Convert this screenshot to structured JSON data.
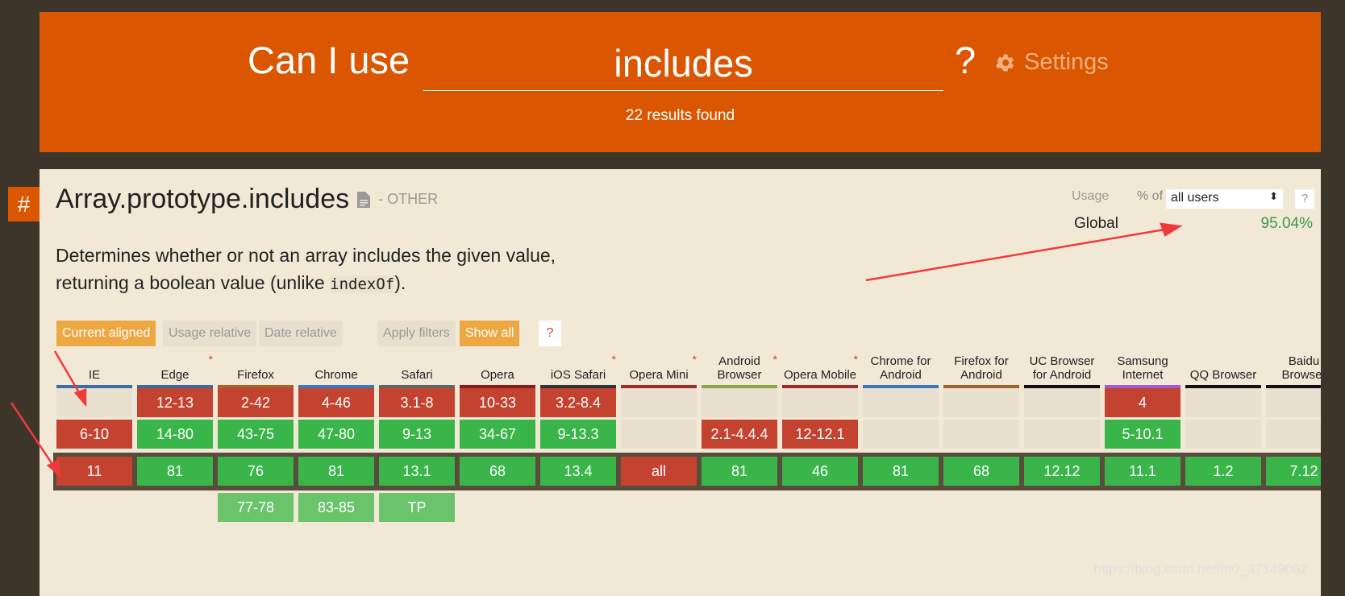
{
  "header": {
    "prefix": "Can I use",
    "query": "includes",
    "suffix": "?",
    "settings_label": "Settings",
    "results": "22 results found"
  },
  "feature": {
    "anchor": "#",
    "title": "Array.prototype.includes",
    "category": "- OTHER",
    "desc_1": "Determines whether or not an array includes the given value,",
    "desc_2a": "returning a boolean value (unlike ",
    "desc_code": "indexOf",
    "desc_2b": ")."
  },
  "usage": {
    "label": "Usage",
    "pct_of": "% of",
    "select_value": "all users",
    "help": "?",
    "region": "Global",
    "value": "95.04%"
  },
  "view_buttons": [
    {
      "label": "Current aligned",
      "active": true
    },
    {
      "label": "Usage relative",
      "active": false
    },
    {
      "label": "Date relative",
      "active": false
    }
  ],
  "filter_buttons": [
    {
      "label": "Apply filters",
      "active": false
    },
    {
      "label": "Show all",
      "active": true
    }
  ],
  "help_button": "?",
  "colors": {
    "header": "#db5600",
    "unsupported": "#c44230",
    "supported": "#39b54a",
    "future": "#6bc46c"
  },
  "browsers": [
    {
      "name": "IE",
      "star": false,
      "stripe": "#3a6ea5",
      "r1": null,
      "r2": [
        "6-10",
        "r"
      ],
      "cur": [
        "11",
        "r"
      ],
      "fut": null
    },
    {
      "name": "Edge",
      "star": true,
      "stripe": "#3f6a9b",
      "r1": [
        "12-13",
        "r"
      ],
      "r2": [
        "14-80",
        "g"
      ],
      "cur": [
        "81",
        "g"
      ],
      "fut": null
    },
    {
      "name": "Firefox",
      "star": false,
      "stripe": "#a4622a",
      "r1": [
        "2-42",
        "r"
      ],
      "r2": [
        "43-75",
        "g"
      ],
      "cur": [
        "76",
        "g"
      ],
      "fut": [
        "77-78",
        "lg"
      ]
    },
    {
      "name": "Chrome",
      "star": false,
      "stripe": "#3b78c0",
      "r1": [
        "4-46",
        "r"
      ],
      "r2": [
        "47-80",
        "g"
      ],
      "cur": [
        "81",
        "g"
      ],
      "fut": [
        "83-85",
        "lg"
      ]
    },
    {
      "name": "Safari",
      "star": false,
      "stripe": "#666666",
      "r1": [
        "3.1-8",
        "r"
      ],
      "r2": [
        "9-13",
        "g"
      ],
      "cur": [
        "13.1",
        "g"
      ],
      "fut": [
        "TP",
        "lg"
      ]
    },
    {
      "name": "Opera",
      "star": false,
      "stripe": "#8b1b1b",
      "r1": [
        "10-33",
        "r"
      ],
      "r2": [
        "34-67",
        "g"
      ],
      "cur": [
        "68",
        "g"
      ],
      "fut": null
    },
    {
      "name": "iOS Safari",
      "star": true,
      "stripe": "#333333",
      "r1": [
        "3.2-8.4",
        "r"
      ],
      "r2": [
        "9-13.3",
        "g"
      ],
      "cur": [
        "13.4",
        "g"
      ],
      "fut": null
    },
    {
      "name": "Opera Mini",
      "star": true,
      "stripe": "#a22a2a",
      "r1": null,
      "r2": null,
      "cur": [
        "all",
        "r"
      ],
      "fut": null
    },
    {
      "name": "Android Browser",
      "star": true,
      "stripe": "#8aa64a",
      "r1": null,
      "r2": [
        "2.1-4.4.4",
        "r"
      ],
      "cur": [
        "81",
        "g"
      ],
      "fut": null
    },
    {
      "name": "Opera Mobile",
      "star": true,
      "stripe": "#a22a2a",
      "r1": null,
      "r2": [
        "12-12.1",
        "r"
      ],
      "cur": [
        "46",
        "g"
      ],
      "fut": null
    },
    {
      "name": "Chrome for Android",
      "star": false,
      "stripe": "#3b78c0",
      "r1": null,
      "r2": null,
      "cur": [
        "81",
        "g"
      ],
      "fut": null
    },
    {
      "name": "Firefox for Android",
      "star": false,
      "stripe": "#a4622a",
      "r1": null,
      "r2": null,
      "cur": [
        "68",
        "g"
      ],
      "fut": null
    },
    {
      "name": "UC Browser for Android",
      "star": false,
      "stripe": "#111111",
      "r1": null,
      "r2": null,
      "cur": [
        "12.12",
        "g"
      ],
      "fut": null
    },
    {
      "name": "Samsung Internet",
      "star": false,
      "stripe": "#a05ad6",
      "r1": [
        "4",
        "r"
      ],
      "r2": [
        "5-10.1",
        "g"
      ],
      "cur": [
        "11.1",
        "g"
      ],
      "fut": null
    },
    {
      "name": "QQ Browser",
      "star": false,
      "stripe": "#111111",
      "r1": null,
      "r2": null,
      "cur": [
        "1.2",
        "g"
      ],
      "fut": null
    },
    {
      "name": "Baidu Browser",
      "star": false,
      "stripe": "#111111",
      "r1": null,
      "r2": null,
      "cur": [
        "7.12",
        "g"
      ],
      "fut": null
    }
  ],
  "watermark": "https://blog.csdn.net/m0_37149062"
}
